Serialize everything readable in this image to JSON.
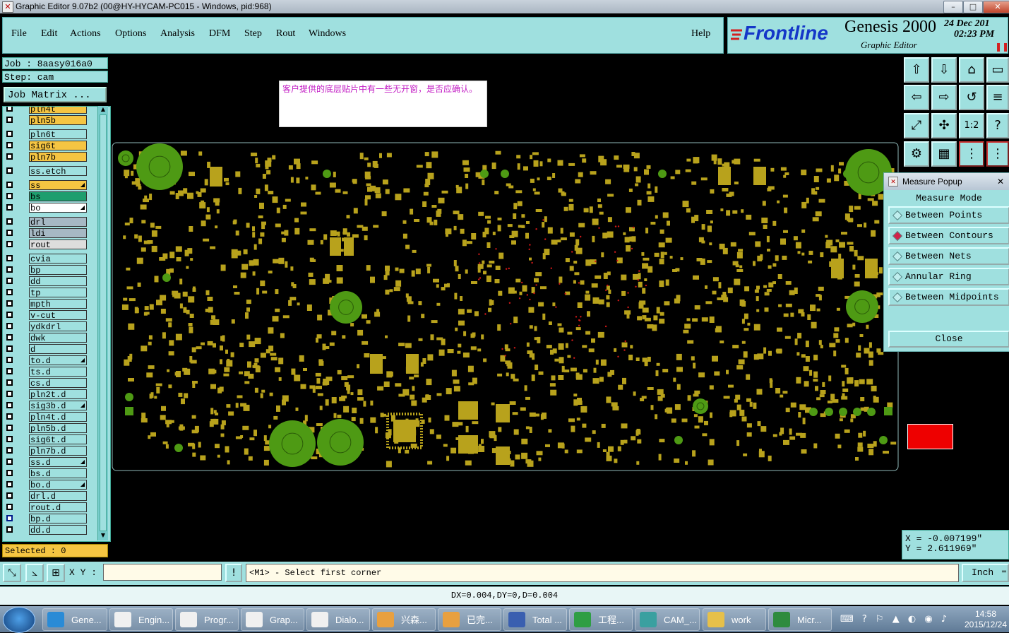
{
  "window": {
    "title": "Graphic Editor 9.07b2 (00@HY-HYCAM-PC015 - Windows, pid:968)",
    "controls": [
      "–",
      "□",
      "✕"
    ]
  },
  "menu": [
    "File",
    "Edit",
    "Actions",
    "Options",
    "Analysis",
    "DFM",
    "Step",
    "Rout",
    "Windows",
    "Help"
  ],
  "brand": {
    "logo": "Frontline",
    "product": "Genesis 2000",
    "subtitle": "Graphic Editor",
    "date": "24 Dec 201",
    "time": "02:23 PM"
  },
  "job": {
    "job_line": "Job : 8aasy016a0",
    "step_line": "Step: cam",
    "matrix_button": "Job Matrix ..."
  },
  "layers": [
    {
      "name": "pln4t",
      "color": "#f5c542",
      "selected": false
    },
    {
      "name": "pln5b",
      "color": "#f5c542",
      "selected": false
    },
    {
      "name": "pln6t",
      "color": "#9fe0df",
      "selected": false
    },
    {
      "name": "sig6t",
      "color": "#f5c542",
      "selected": false
    },
    {
      "name": "pln7b",
      "color": "#f5c542",
      "selected": false
    },
    {
      "name": "ss.etch",
      "color": "#9fe0df",
      "selected": false
    },
    {
      "name": "ss",
      "color": "#f5c542",
      "selected": true
    },
    {
      "name": "bs",
      "color": "#1e9e6e",
      "selected": false
    },
    {
      "name": "bo",
      "color": "#ffffff",
      "selected": true
    },
    {
      "name": "drl",
      "color": "#a6b8c4",
      "selected": false
    },
    {
      "name": "ldi",
      "color": "#a6b8c4",
      "selected": false
    },
    {
      "name": "rout",
      "color": "#dddddd",
      "selected": false
    },
    {
      "name": "cvia",
      "color": "#9fe0df",
      "selected": false
    },
    {
      "name": "bp",
      "color": "#9fe0df",
      "selected": false
    },
    {
      "name": "dd",
      "color": "#9fe0df",
      "selected": false
    },
    {
      "name": "tp",
      "color": "#9fe0df",
      "selected": false
    },
    {
      "name": "mpth",
      "color": "#9fe0df",
      "selected": false
    },
    {
      "name": "v-cut",
      "color": "#9fe0df",
      "selected": false
    },
    {
      "name": "ydkdrl",
      "color": "#9fe0df",
      "selected": false
    },
    {
      "name": "dwk",
      "color": "#9fe0df",
      "selected": false
    },
    {
      "name": "d",
      "color": "#9fe0df",
      "selected": false
    },
    {
      "name": "to.d",
      "color": "#9fe0df",
      "selected": true
    },
    {
      "name": "ts.d",
      "color": "#9fe0df",
      "selected": false
    },
    {
      "name": "cs.d",
      "color": "#9fe0df",
      "selected": false
    },
    {
      "name": "pln2t.d",
      "color": "#9fe0df",
      "selected": false
    },
    {
      "name": "sig3b.d",
      "color": "#9fe0df",
      "selected": true
    },
    {
      "name": "pln4t.d",
      "color": "#9fe0df",
      "selected": false
    },
    {
      "name": "pln5b.d",
      "color": "#9fe0df",
      "selected": false
    },
    {
      "name": "sig6t.d",
      "color": "#9fe0df",
      "selected": false
    },
    {
      "name": "pln7b.d",
      "color": "#9fe0df",
      "selected": false
    },
    {
      "name": "ss.d",
      "color": "#9fe0df",
      "selected": true
    },
    {
      "name": "bs.d",
      "color": "#9fe0df",
      "selected": false
    },
    {
      "name": "bo.d",
      "color": "#9fe0df",
      "selected": true
    },
    {
      "name": "drl.d",
      "color": "#9fe0df",
      "selected": false
    },
    {
      "name": "rout.d",
      "color": "#9fe0df",
      "selected": false
    },
    {
      "name": "bp.d",
      "color": "#9fe0df",
      "selected": false
    },
    {
      "name": "dd.d",
      "color": "#9fe0df",
      "selected": false
    }
  ],
  "selected_count": "Selected : 0",
  "canvas_note": "客户提供的底层贴片中有一些无开窗，是否应确认。",
  "measure_popup": {
    "title": "Measure Popup",
    "mode_label": "Measure Mode",
    "options": [
      {
        "label": "Between Points",
        "active": false
      },
      {
        "label": "Between Contours",
        "active": true
      },
      {
        "label": "Between Nets",
        "active": false
      },
      {
        "label": "Annular Ring",
        "active": false
      },
      {
        "label": "Between Midpoints",
        "active": false
      }
    ],
    "close_label": "Close"
  },
  "coords": {
    "x": "X = -0.007199\"",
    "y": "Y = 2.611969\""
  },
  "bottom": {
    "xy_label": "X Y :",
    "prompt": "<M1> - Select first corner",
    "unit": "Inch"
  },
  "status": "DX=0.004,DY=0,D=0.004",
  "taskbar": {
    "items": [
      "Gene...",
      "Engin...",
      "Progr...",
      "Grap...",
      "Dialo...",
      "兴森...",
      "已完...",
      "Total ...",
      "工程...",
      "CAM_...",
      "work",
      "Micr..."
    ],
    "clock_time": "14:58",
    "clock_date": "2015/12/24"
  },
  "colors": {
    "panel": "#9fe0df",
    "pad": "#b8a21c",
    "via_ring": "#4e9a14",
    "highlight": "#f5c542",
    "board_outline": "#8fb8b8"
  }
}
